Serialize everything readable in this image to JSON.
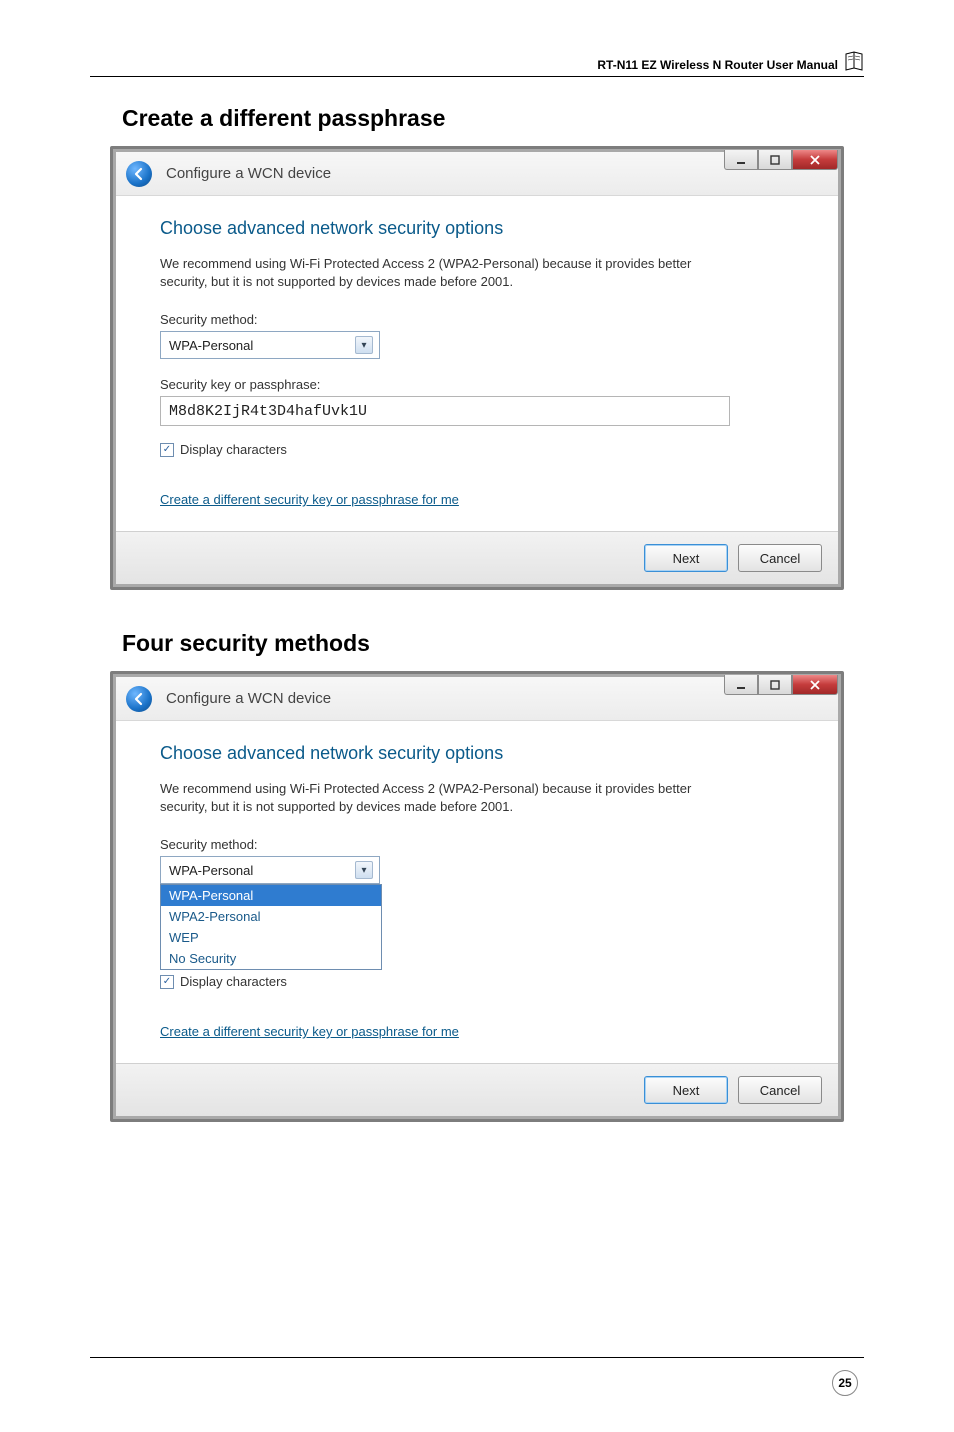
{
  "header": {
    "manual_title": "RT-N11 EZ Wireless N Router User Manual"
  },
  "section1_title": "Create a different passphrase",
  "section2_title": "Four security methods",
  "dlg": {
    "window_title": "Configure a WCN device",
    "heading": "Choose advanced network security options",
    "desc": "We recommend using Wi-Fi Protected Access 2 (WPA2-Personal) because it provides better security,  but it is not supported by devices made before 2001.",
    "security_method_label": "Security method:",
    "security_method_value": "WPA-Personal",
    "passphrase_label": "Security key or passphrase:",
    "passphrase_value": "M8d8K2IjR4t3D4hafUvk1U",
    "display_chars": "Display characters",
    "link": "Create a different security key or passphrase for me",
    "next": "Next",
    "cancel": "Cancel",
    "options": {
      "o1": "WPA-Personal",
      "o2": "WPA2-Personal",
      "o3": "WEP",
      "o4": "No Security"
    }
  },
  "page_number": "25"
}
